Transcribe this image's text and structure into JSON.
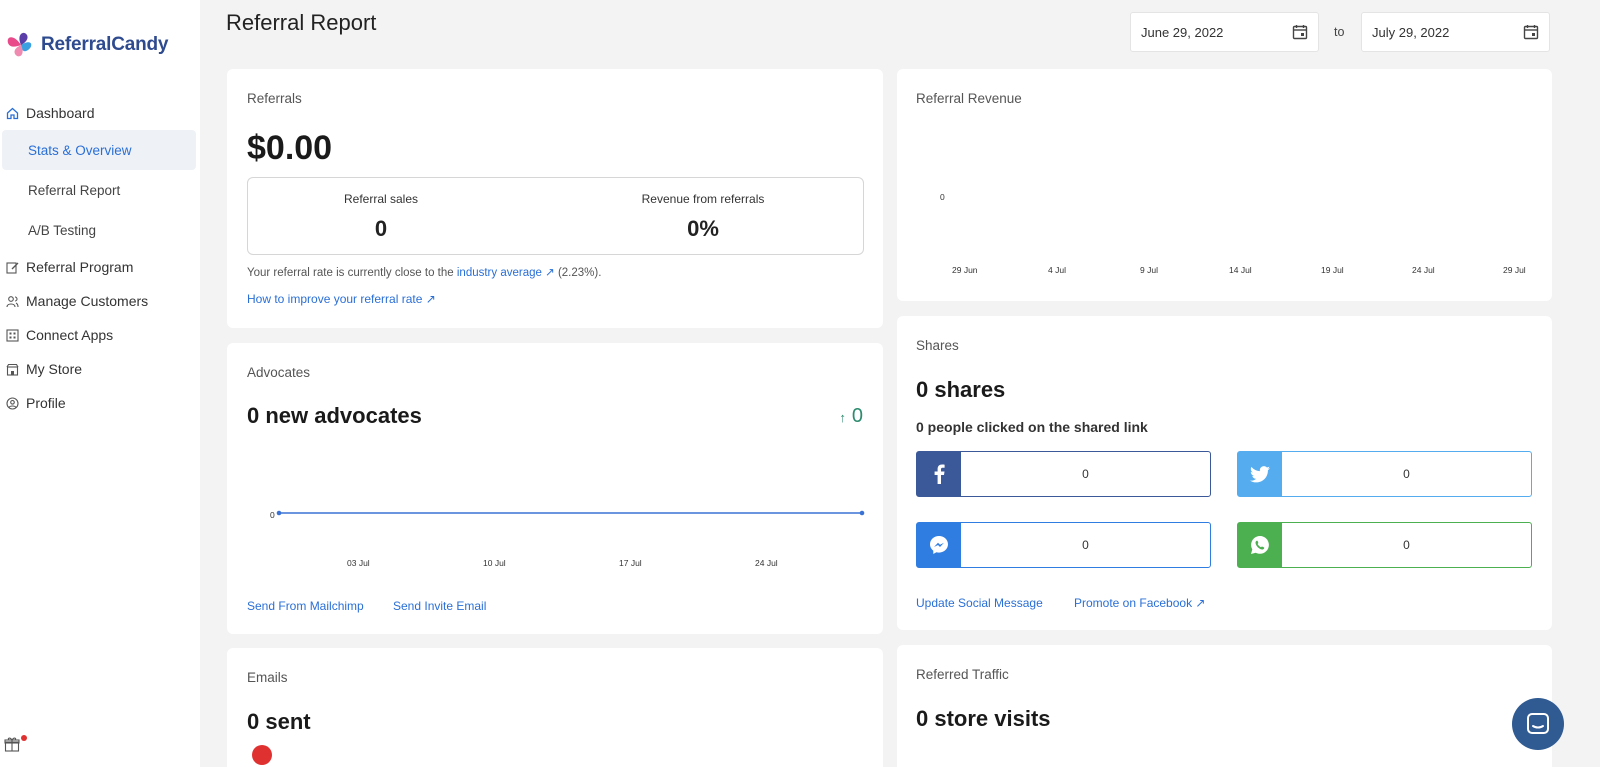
{
  "brand": {
    "name": "ReferralCandy"
  },
  "sidebar": {
    "dashboard": "Dashboard",
    "subitems": [
      "Stats & Overview",
      "Referral Report",
      "A/B Testing"
    ],
    "items": [
      "Referral Program",
      "Manage Customers",
      "Connect Apps",
      "My Store",
      "Profile"
    ]
  },
  "header": {
    "title": "Referral Report",
    "date_from": "June 29, 2022",
    "to_label": "to",
    "date_to": "July 29, 2022"
  },
  "referrals": {
    "title": "Referrals",
    "amount": "$0.00",
    "sales_label": "Referral sales",
    "sales_value": "0",
    "revenue_label": "Revenue from referrals",
    "revenue_value": "0%",
    "rate_text_before": "Your referral rate is currently close to the",
    "rate_link": "industry average",
    "rate_text_after": "(2.23%).",
    "improve_link": "How to improve your referral rate"
  },
  "revenue": {
    "title": "Referral Revenue",
    "zero": "0",
    "xticks": [
      "29 Jun",
      "4 Jul",
      "9 Jul",
      "14 Jul",
      "19 Jul",
      "24 Jul",
      "29 Jul"
    ]
  },
  "advocates": {
    "title": "Advocates",
    "headline": "0 new advocates",
    "change": "0",
    "zero": "0",
    "xticks": [
      "03 Jul",
      "10 Jul",
      "17 Jul",
      "24 Jul"
    ],
    "link_mailchimp": "Send From Mailchimp",
    "link_invite": "Send Invite Email"
  },
  "shares": {
    "title": "Shares",
    "headline": "0 shares",
    "clicked": "0 people clicked on the shared link",
    "facebook": "0",
    "twitter": "0",
    "messenger": "0",
    "whatsapp": "0",
    "link_update": "Update Social Message",
    "link_promote": "Promote on Facebook",
    "colors": {
      "facebook": "#3b5998",
      "twitter": "#55acee",
      "messenger": "#2f7de1",
      "whatsapp": "#4caf50"
    }
  },
  "emails": {
    "title": "Emails",
    "headline": "0 sent"
  },
  "traffic": {
    "title": "Referred Traffic",
    "headline": "0 store visits"
  }
}
